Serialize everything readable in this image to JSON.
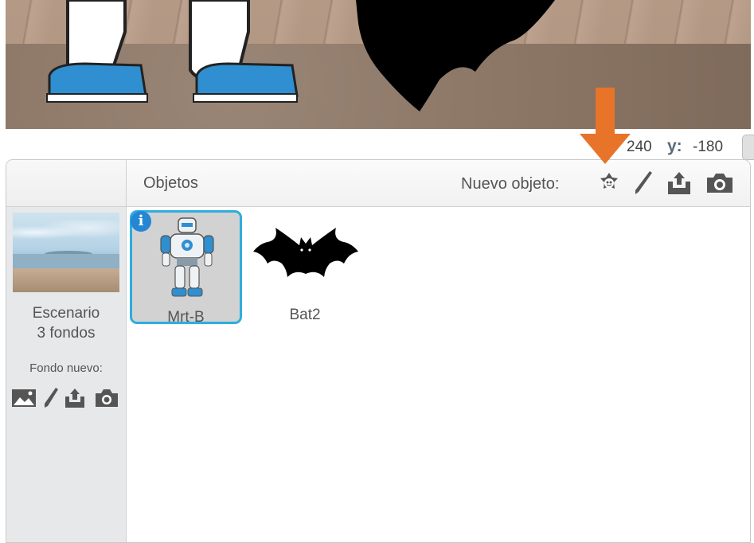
{
  "stage": {
    "x_value": "240",
    "y_label": "y:",
    "y_value": "-180"
  },
  "sprites_pane": {
    "title": "Objetos",
    "new_sprite_label": "Nuevo objeto:",
    "toolbar_icons": [
      "sprite-library-icon",
      "paint-brush-icon",
      "upload-icon",
      "camera-icon"
    ]
  },
  "stage_panel": {
    "name": "Escenario",
    "backdrops": "3 fondos",
    "new_backdrop_label": "Fondo nuevo:",
    "backdrop_icons": [
      "image-library-icon",
      "paint-brush-icon",
      "upload-icon",
      "camera-icon"
    ]
  },
  "sprites": [
    {
      "name": "Mrt-B",
      "selected": true,
      "info_glyph": "i"
    },
    {
      "name": "Bat2",
      "selected": false
    }
  ],
  "colors": {
    "accent": "#2eadde",
    "arrow": "#e8742a",
    "info": "#2486d4"
  }
}
